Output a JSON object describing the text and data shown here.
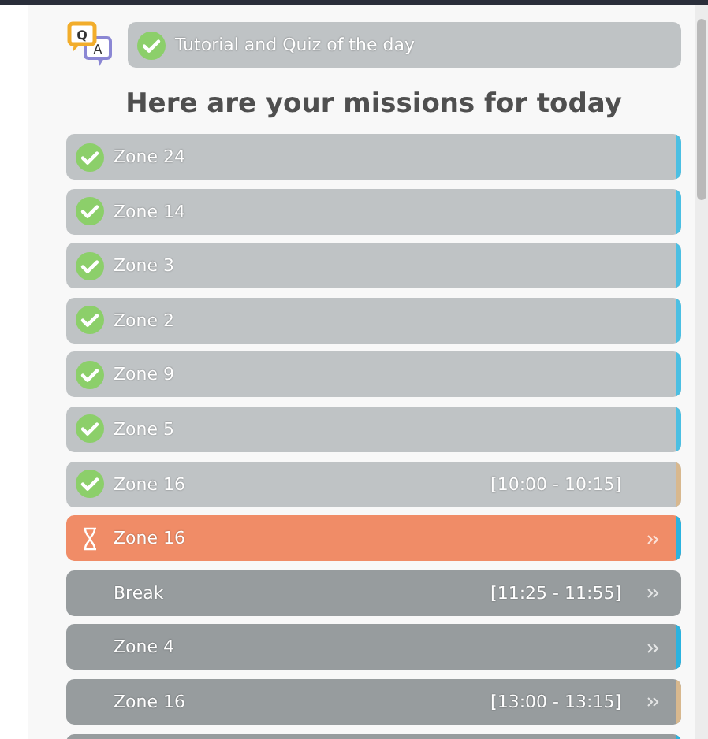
{
  "quiz": {
    "icon_q": "Q",
    "icon_a": "A",
    "label": "Tutorial and Quiz of the day",
    "done": true
  },
  "heading": "Here are your missions for today",
  "missions": [
    {
      "name": "Zone 24",
      "kind": "done",
      "color": "#4bbfe3"
    },
    {
      "name": "Zone 14",
      "kind": "done",
      "color": "#4bbfe3"
    },
    {
      "name": "Zone 3",
      "kind": "done",
      "color": "#4bbfe3"
    },
    {
      "name": "Zone 2",
      "kind": "done",
      "color": "#4bbfe3"
    },
    {
      "name": "Zone 9",
      "kind": "done",
      "color": "#4bbfe3"
    },
    {
      "name": "Zone 5",
      "kind": "done",
      "color": "#4bbfe3"
    },
    {
      "name": "Zone 16",
      "kind": "done",
      "time": "[10:00 - 10:15]",
      "color": "#d8b88e"
    },
    {
      "name": "Zone 16",
      "kind": "active",
      "color": "#2bb3e0"
    },
    {
      "name": "Break",
      "kind": "pending",
      "time": "[11:25 - 11:55]"
    },
    {
      "name": "Zone 4",
      "kind": "pending",
      "color": "#2bb3e0"
    },
    {
      "name": "Zone 16",
      "kind": "pending",
      "time": "[13:00 - 13:15]",
      "color": "#d8b88e"
    },
    {
      "kind": "pending",
      "color": "#2bb3e0"
    }
  ]
}
